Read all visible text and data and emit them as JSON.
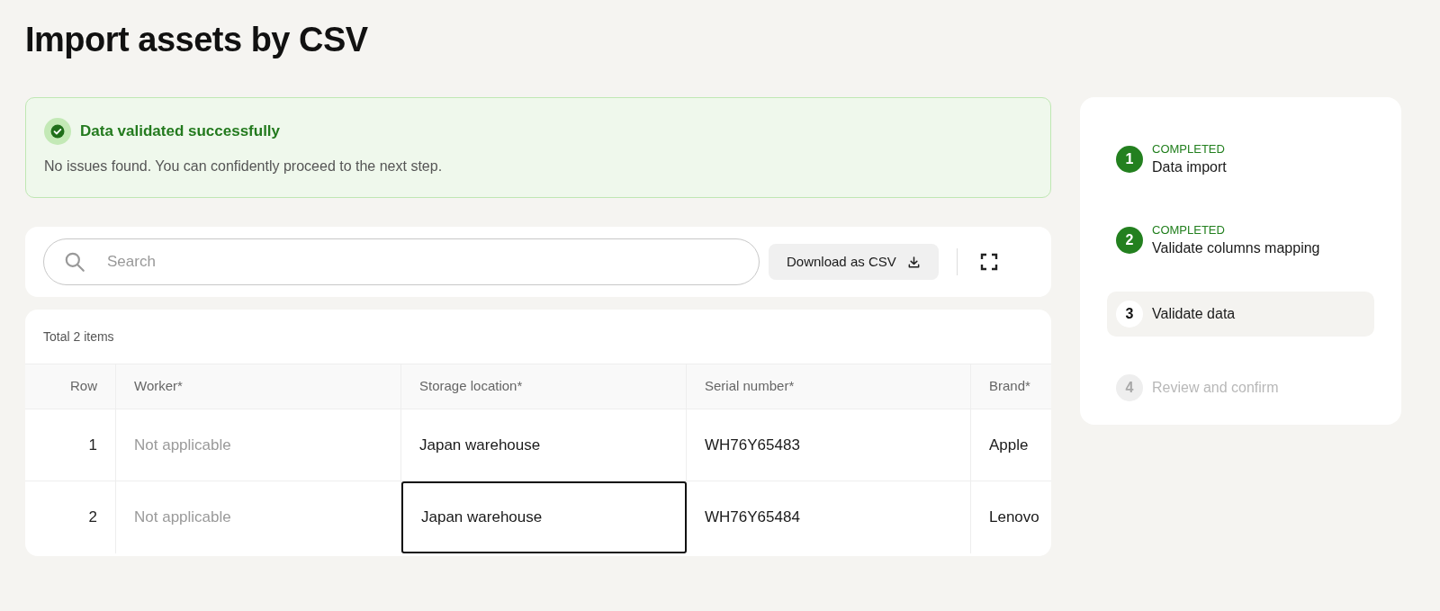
{
  "title": "Import assets by CSV",
  "alert": {
    "title": "Data validated successfully",
    "message": "No issues found. You can confidently proceed to the next step."
  },
  "toolbar": {
    "search": {
      "placeholder": "Search"
    },
    "download_button": "Download as CSV"
  },
  "table": {
    "total": "Total 2 items",
    "columns": [
      "Row",
      "Worker*",
      "Storage location*",
      "Serial number*",
      "Brand*"
    ],
    "rows": [
      {
        "cells": [
          {
            "text": "1",
            "kind": "number",
            "selected": false
          },
          {
            "text": "Not applicable",
            "kind": "na",
            "selected": false
          },
          {
            "text": "Japan warehouse",
            "kind": "value",
            "selected": false
          },
          {
            "text": "WH76Y65483",
            "kind": "value",
            "selected": false
          },
          {
            "text": "Apple",
            "kind": "value",
            "selected": false
          }
        ]
      },
      {
        "cells": [
          {
            "text": "2",
            "kind": "number",
            "selected": false
          },
          {
            "text": "Not applicable",
            "kind": "na",
            "selected": false
          },
          {
            "text": "Japan warehouse",
            "kind": "value",
            "selected": true
          },
          {
            "text": "WH76Y65484",
            "kind": "value",
            "selected": false
          },
          {
            "text": "Lenovo",
            "kind": "value",
            "selected": false
          }
        ]
      }
    ]
  },
  "steps": [
    {
      "number": "1",
      "label": "Data import",
      "completed": true,
      "current": false,
      "status_label": "COMPLETED"
    },
    {
      "number": "2",
      "label": "Validate columns mapping",
      "completed": true,
      "current": false,
      "status_label": "COMPLETED"
    },
    {
      "number": "3",
      "label": "Validate data",
      "completed": false,
      "current": true
    },
    {
      "number": "4",
      "label": "Review and confirm",
      "completed": false,
      "current": false
    }
  ]
}
